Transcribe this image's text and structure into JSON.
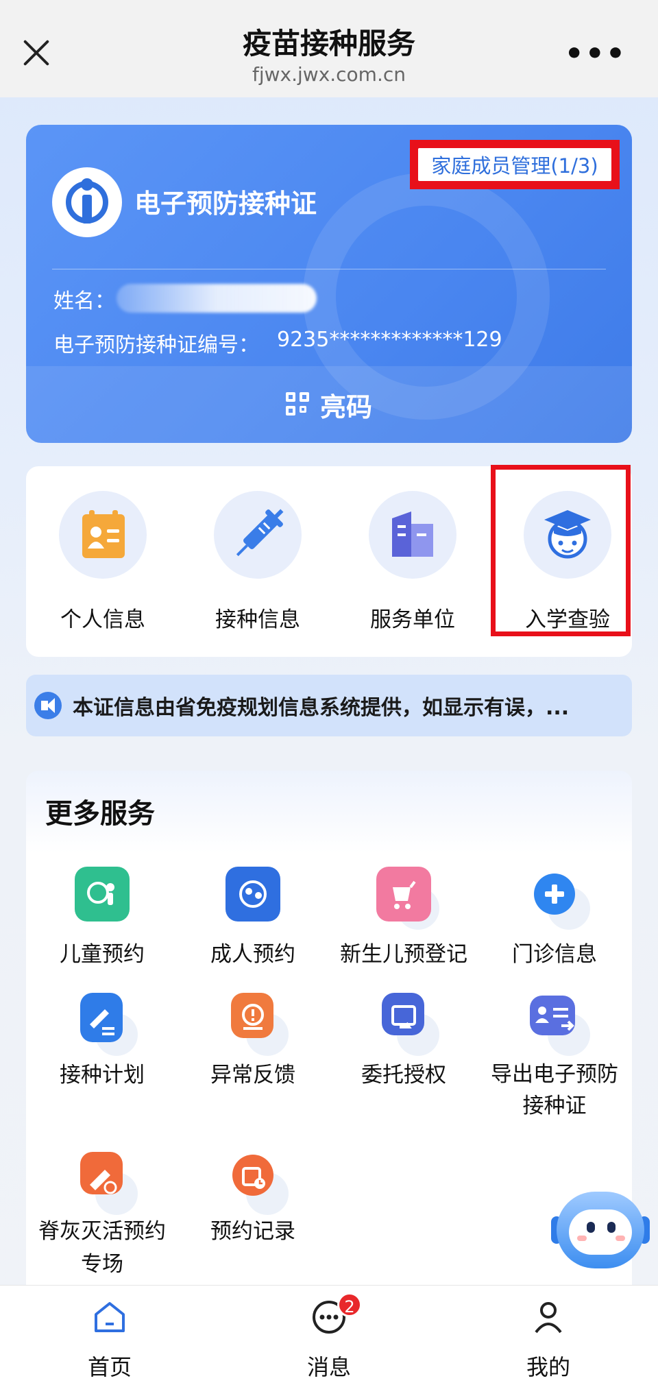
{
  "header": {
    "title": "疫苗接种服务",
    "url": "fjwx.jwx.com.cn",
    "more_label": "•••"
  },
  "card": {
    "title": "电子预防接种证",
    "family_button": "家庭成员管理(1/3)",
    "name_label": "姓名：",
    "id_label": "电子预防接种证编号：",
    "id_value": "9235*************129",
    "show_code_label": "亮码",
    "colors": {
      "card_bg": "#4a86f0",
      "highlight": "#e8101a"
    }
  },
  "quick": {
    "items": [
      {
        "label": "个人信息",
        "icon": "id-card-icon"
      },
      {
        "label": "接种信息",
        "icon": "syringe-icon"
      },
      {
        "label": "服务单位",
        "icon": "building-icon"
      },
      {
        "label": "入学查验",
        "icon": "graduation-cap-icon"
      }
    ]
  },
  "notice": {
    "text": "本证信息由省免疫规划信息系统提供，如显示有误，..."
  },
  "more_services": {
    "title": "更多服务",
    "items": [
      {
        "label": "儿童预约",
        "icon": "child-icon",
        "color": "#2fbf8f"
      },
      {
        "label": "成人预约",
        "icon": "adult-icon",
        "color": "#2f6fe0"
      },
      {
        "label": "新生儿预登记",
        "icon": "stroller-icon",
        "color": "#f27aa0"
      },
      {
        "label": "门诊信息",
        "icon": "clinic-plus-icon",
        "color": "#2f86f0"
      },
      {
        "label": "接种计划",
        "icon": "plan-icon",
        "color": "#2f7ce8"
      },
      {
        "label": "异常反馈",
        "icon": "feedback-icon",
        "color": "#f07a3e"
      },
      {
        "label": "委托授权",
        "icon": "authorize-icon",
        "color": "#4766d8"
      },
      {
        "label": "导出电子预防",
        "label2": "接种证",
        "icon": "export-card-icon",
        "color": "#5a6fe0"
      },
      {
        "label": "脊灰灭活预约",
        "label2": "专场",
        "icon": "polio-icon",
        "color": "#f06a3a"
      },
      {
        "label": "预约记录",
        "icon": "records-icon",
        "color": "#f06a3a"
      }
    ]
  },
  "bottom_nav": {
    "items": [
      {
        "label": "首页",
        "icon": "home-icon"
      },
      {
        "label": "消息",
        "icon": "message-icon",
        "badge": "2"
      },
      {
        "label": "我的",
        "icon": "profile-icon"
      }
    ]
  }
}
